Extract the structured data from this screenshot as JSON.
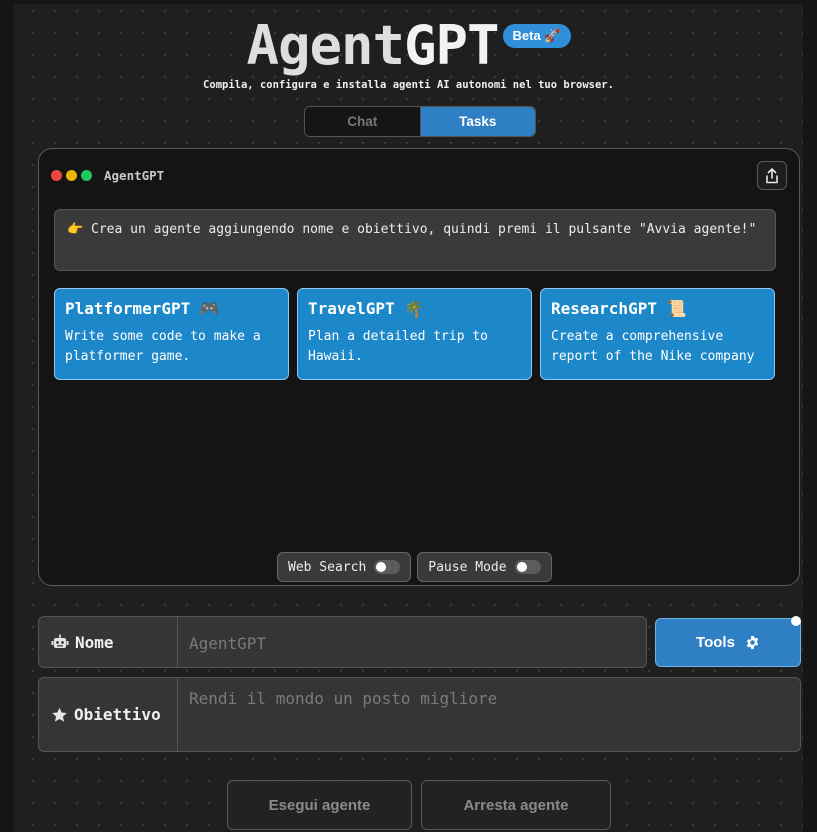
{
  "header": {
    "title_part1": "Agent",
    "title_part2": "GPT",
    "badge": "Beta",
    "badge_icon": "rocket-icon",
    "subtitle": "Compila, configura e installa agenti AI autonomi nel tuo browser."
  },
  "mode_toggle": {
    "chat_label": "Chat",
    "tasks_label": "Tasks",
    "selected": "Tasks"
  },
  "window": {
    "title": "AgentGPT",
    "instruction": "👉 Crea un agente aggiungendo nome e obiettivo, quindi premi il pulsante \"Avvia agente!\"",
    "cards": [
      {
        "title": "PlatformerGPT 🎮",
        "description": "Write some code to make a platformer game."
      },
      {
        "title": "TravelGPT 🌴",
        "description": "Plan a detailed trip to Hawaii."
      },
      {
        "title": "ResearchGPT 📜",
        "description": "Create a comprehensive report of the Nike company"
      }
    ],
    "toggles": [
      {
        "label": "Web Search",
        "on": false
      },
      {
        "label": "Pause Mode",
        "on": false
      }
    ]
  },
  "form": {
    "name_label": "Nome",
    "name_placeholder": "AgentGPT",
    "goal_label": "Obiettivo",
    "goal_placeholder": "Rendi il mondo un posto migliore",
    "tools_label": "Tools"
  },
  "actions": {
    "run_label": "Esegui agente",
    "stop_label": "Arresta agente"
  },
  "colors": {
    "accent": "#2f7fc4",
    "card": "#1c87c9",
    "background": "#1f1f1f"
  }
}
